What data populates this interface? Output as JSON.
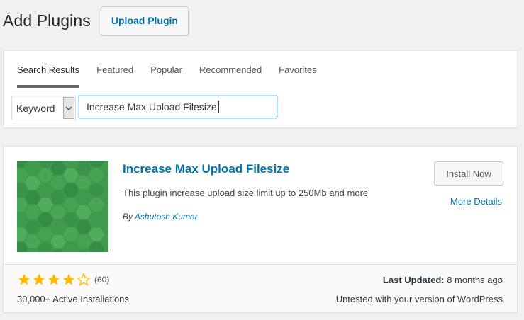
{
  "header": {
    "title": "Add Plugins",
    "upload_label": "Upload Plugin"
  },
  "tabs": [
    {
      "label": "Search Results"
    },
    {
      "label": "Featured"
    },
    {
      "label": "Popular"
    },
    {
      "label": "Recommended"
    },
    {
      "label": "Favorites"
    }
  ],
  "search": {
    "type_selected": "Keyword",
    "query": "Increase Max Upload Filesize"
  },
  "plugin": {
    "name": "Increase Max Upload Filesize",
    "description": "This plugin increase upload size limit up to 250Mb and more",
    "author_prefix": "By",
    "author": "Ashutosh Kumar",
    "install_label": "Install Now",
    "more_details_label": "More Details",
    "rating_stars": 4,
    "rating_max": 5,
    "rating_count": "(60)",
    "installs": "30,000+ Active Installations",
    "last_updated_label": "Last Updated:",
    "last_updated_value": "8 months ago",
    "compat": "Untested with your version of WordPress"
  },
  "colors": {
    "link": "#0073aa",
    "star": "#ffb900",
    "icon_green": "#3e9a4c"
  },
  "icons": [
    "chevron-down-icon",
    "star-icon",
    "plugin-hexagon-icon"
  ]
}
